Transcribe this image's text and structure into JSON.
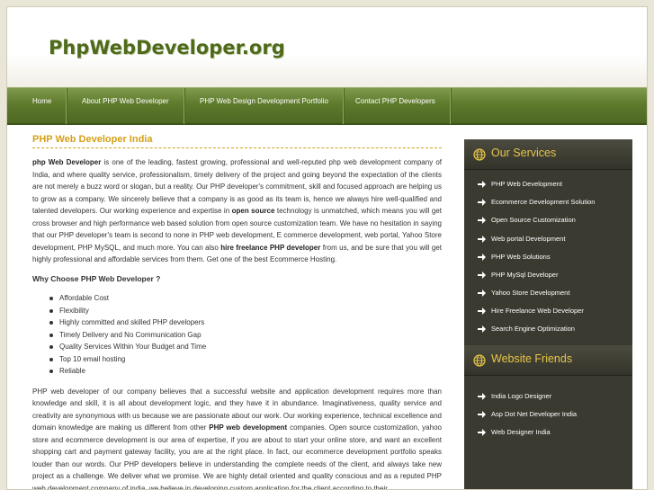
{
  "site": {
    "logo": "PhpWebDeveloper.org"
  },
  "nav": [
    {
      "label": "Home"
    },
    {
      "label": "About PHP Web Developer"
    },
    {
      "label": "PHP Web Design Development Portfolio"
    },
    {
      "label": "Contact PHP Developers"
    }
  ],
  "main": {
    "title": "PHP Web Developer India",
    "intro": {
      "s1b": "php Web Developer",
      "s1": " is one of the leading, fastest growing, professional and well-reputed php web development company of India, and where quality service, professionalism, timely delivery of the project and going beyond the expectation of the clients are not merely a buzz word or slogan, but a reality. Our PHP developer's commitment, skill and focused approach are helping us to grow as a company. We sincerely believe that a company is as good as its team is, hence we always hire well-qualified and talented developers. Our working experience and expertise in ",
      "s2b": "open source",
      "s2": " technology is unmatched, which means you will get cross browser and high performance web based solution from open source customization team. We have no hesitation in saying that our PHP developer's team is second to none in PHP web development, E commerce development, web portal, Yahoo Store development, PHP MySQL, and much more. You can also ",
      "s3b": "hire freelance PHP developer",
      "s3": " from us, and be sure that you will get highly professional and affordable services from them. Get one of the best Ecommerce Hosting."
    },
    "why_title": "Why Choose PHP Web Developer ?",
    "why_list": [
      "Affordable Cost",
      "Flexibility",
      "Highly committed and skilled PHP developers",
      "Timely Delivery and No Communication Gap",
      "Quality Services Within Your Budget and Time",
      "Top 10 email hosting",
      "Reliable"
    ],
    "para2": {
      "s1": "PHP web developer of our company believes that a successful website and application development requires more than knowledge and skill, it is all about development logic, and they have it in abundance. Imaginativeness, quality service and creativity are synonymous with us because we are passionate about our work. Our working experience, technical excellence and domain knowledge are making us different from other ",
      "s2b": "PHP web development",
      "s2": " companies. Open source customization, yahoo store and ecommerce development is our area of expertise, if you are about to start your online store, and want an excellent shopping cart and payment gateway facility, you are at the right place. In fact, our ecommerce development portfolio speaks louder than our words. Our PHP developers believe in understanding the complete needs of the client, and always take new project as a challenge. We deliver what we promise. We are highly detail oriented and quality conscious and as a reputed PHP web development company of india, we believe in developing custom application for the client according to their"
    }
  },
  "sidebar": {
    "services_title": "Our Services",
    "services": [
      "PHP Web Development",
      "Ecommerce Development Solution",
      "Open Source Customization",
      "Web portal Development",
      "PHP Web Solutions",
      "PHP MySql Developer",
      "Yahoo Store Development",
      "Hire Freelance Web Developer",
      "Search Engine Optimization"
    ],
    "friends_title": "Website Friends",
    "friends": [
      "India Logo Designer",
      "Asp Dot Net Developer India",
      "Web Designer India"
    ]
  },
  "colors": {
    "brand_green": "#4e6a1a",
    "heading_gold": "#d4a017",
    "sidebar_bg": "#3a3a30",
    "sidebar_title": "#e8c54a"
  }
}
